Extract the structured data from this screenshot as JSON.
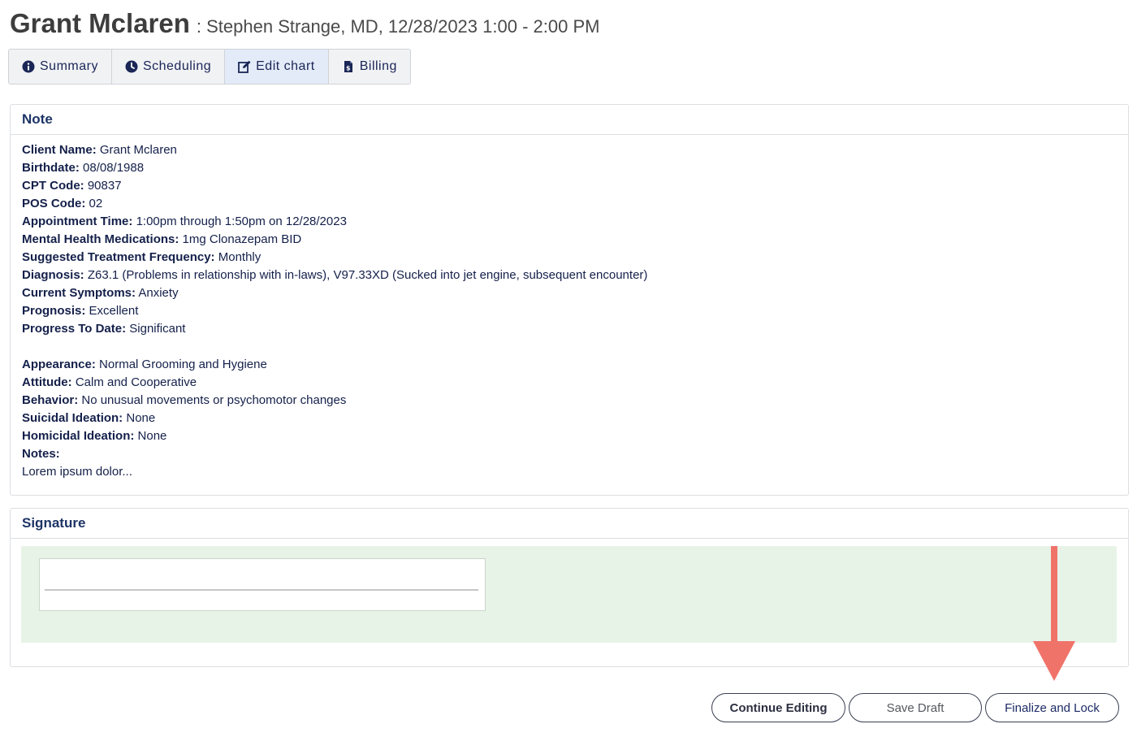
{
  "header": {
    "client_name": "Grant Mclaren",
    "subtitle": ": Stephen Strange, MD, 12/28/2023 1:00 - 2:00 PM"
  },
  "tabs": [
    {
      "label": "Summary",
      "icon": "info-circle-icon",
      "active": false
    },
    {
      "label": "Scheduling",
      "icon": "clock-icon",
      "active": false
    },
    {
      "label": "Edit chart",
      "icon": "edit-icon",
      "active": true
    },
    {
      "label": "Billing",
      "icon": "invoice-icon",
      "active": false
    }
  ],
  "note": {
    "title": "Note",
    "fields": [
      {
        "label": "Client Name:",
        "value": "Grant Mclaren"
      },
      {
        "label": "Birthdate:",
        "value": "08/08/1988"
      },
      {
        "label": "CPT Code:",
        "value": "90837"
      },
      {
        "label": "POS Code:",
        "value": "02"
      },
      {
        "label": "Appointment Time:",
        "value": "1:00pm through 1:50pm on 12/28/2023"
      },
      {
        "label": "Mental Health Medications:",
        "value": "1mg Clonazepam BID"
      },
      {
        "label": "Suggested Treatment Frequency:",
        "value": "Monthly"
      },
      {
        "label": "Diagnosis:",
        "value": "Z63.1 (Problems in relationship with in-laws), V97.33XD (Sucked into jet engine, subsequent encounter)"
      },
      {
        "label": "Current Symptoms:",
        "value": "Anxiety"
      },
      {
        "label": "Prognosis:",
        "value": "Excellent"
      },
      {
        "label": "Progress To Date:",
        "value": "Significant"
      }
    ],
    "mental_status": [
      {
        "label": "Appearance:",
        "value": "Normal Grooming and Hygiene"
      },
      {
        "label": "Attitude:",
        "value": "Calm and Cooperative"
      },
      {
        "label": "Behavior:",
        "value": "No unusual movements or psychomotor changes"
      },
      {
        "label": "Suicidal Ideation:",
        "value": "None"
      },
      {
        "label": "Homicidal Ideation:",
        "value": "None"
      }
    ],
    "notes_label": "Notes:",
    "notes_text": "Lorem ipsum dolor..."
  },
  "signature": {
    "title": "Signature"
  },
  "buttons": {
    "continue": "Continue Editing",
    "save": "Save Draft",
    "finalize": "Finalize and Lock"
  },
  "colors": {
    "accent_arrow": "#f07369",
    "text_primary": "#14204a",
    "signature_bg": "#e8f3e8",
    "active_tab_bg": "#e3ebf8"
  }
}
